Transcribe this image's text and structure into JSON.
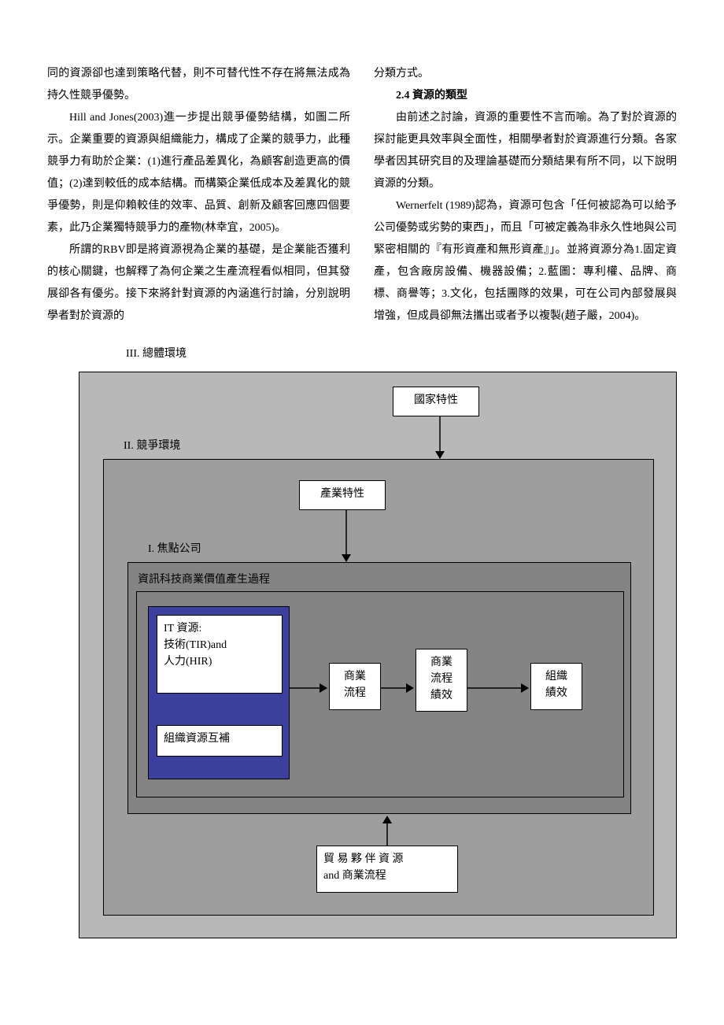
{
  "columns": {
    "left": {
      "p1": "同的資源卻也達到策略代替，則不可替代性不存在將無法成為持久性競爭優勢。",
      "p2": "Hill and Jones(2003)進一步提出競爭優勢結構，如圖二所示。企業重要的資源與組織能力，構成了企業的競爭力，此種競爭力有助於企業：(1)進行產品差異化，為顧客創造更高的價值；(2)達到較低的成本結構。而構築企業低成本及差異化的競爭優勢，則是仰賴較佳的效率、品質、創新及顧客回應四個要素，此乃企業獨特競爭力的產物(林幸宜，2005)。",
      "p3": "所謂的RBV即是將資源視為企業的基礎，是企業能否獲利的核心關鍵，也解釋了為何企業之生產流程看似相同，但其發展卻各有優劣。接下來將針對資源的內涵進行討論，分別說明學者對於資源的"
    },
    "right": {
      "p1": "分類方式。",
      "heading": "2.4 資源的類型",
      "p2": "由前述之討論，資源的重要性不言而喻。為了對於資源的探討能更具效率與全面性，相關學者對於資源進行分類。各家學者因其研究目的及理論基礎而分類結果有所不同，以下說明資源的分類。",
      "p3": "Wernerfelt (1989)認為，資源可包含「任何被認為可以給予公司優勢或劣勢的東西」，而且「可被定義為非永久性地與公司緊密相關的『有形資產和無形資產』」。並將資源分為1.固定資產，包含廠房設備、機器設備；2.藍圖：專利權、品牌、商標、商譽等；3.文化，包括團隊的效果，可在公司內部發展與增強，但成員卻無法攜出或者予以複製(趙子嚴，2004)。"
    }
  },
  "diagram": {
    "title": "III. 總體環境",
    "layer2_label": "II. 競爭環境",
    "layer1_label": "I. 焦點公司",
    "inner_title": "資訊科技商業價值產生過程",
    "boxes": {
      "nation": "國家特性",
      "industry": "產業特性",
      "it_line1": "IT 資源:",
      "it_line2": "技術(TIR)and",
      "it_line3": "人力(HIR)",
      "complementary": "組織資源互補",
      "bp_line1": "商業",
      "bp_line2": "流程",
      "bpp_line1": "商業",
      "bpp_line2": "流程",
      "bpp_line3": "績效",
      "op_line1": "組織",
      "op_line2": "績效",
      "partner_line1": "貿 易 夥 伴 資 源",
      "partner_line2": "and 商業流程"
    }
  }
}
